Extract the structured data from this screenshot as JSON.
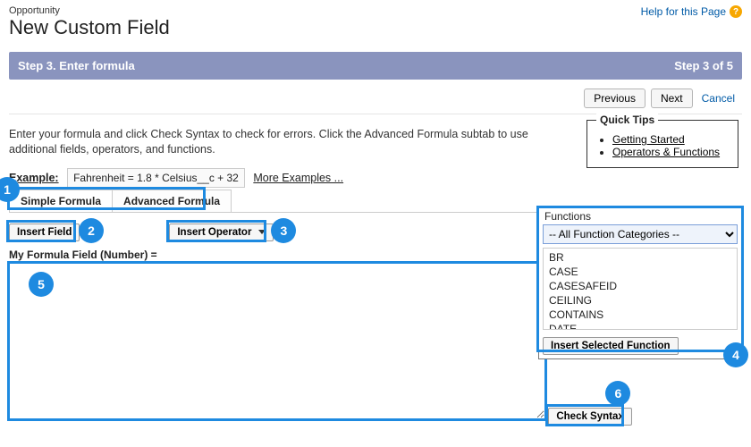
{
  "header": {
    "breadcrumb": "Opportunity",
    "title": "New Custom Field",
    "help_link": "Help for this Page"
  },
  "step_bar": {
    "left": "Step 3. Enter formula",
    "right": "Step 3 of 5"
  },
  "nav": {
    "previous": "Previous",
    "next": "Next",
    "cancel": "Cancel"
  },
  "instructions": "Enter your formula and click Check Syntax to check for errors. Click the Advanced Formula subtab to use additional fields, operators, and functions.",
  "quick_tips": {
    "title": "Quick Tips",
    "links": [
      "Getting Started",
      "Operators & Functions"
    ]
  },
  "example": {
    "label": "Example:",
    "formula": "Fahrenheit = 1.8 * Celsius__c + 32",
    "more": "More Examples ..."
  },
  "tabs": {
    "simple": "Simple Formula",
    "advanced": "Advanced Formula"
  },
  "editor": {
    "insert_field": "Insert Field",
    "insert_operator": "Insert Operator",
    "field_label": "My Formula Field (Number) =",
    "textarea_value": "",
    "check_syntax": "Check Syntax"
  },
  "functions": {
    "title": "Functions",
    "category": "-- All Function Categories --",
    "list": [
      "BR",
      "CASE",
      "CASESAFEID",
      "CEILING",
      "CONTAINS",
      "DATE"
    ],
    "insert_selected": "Insert Selected Function"
  },
  "annotations": {
    "a1": "1",
    "a2": "2",
    "a3": "3",
    "a4": "4",
    "a5": "5",
    "a6": "6"
  }
}
